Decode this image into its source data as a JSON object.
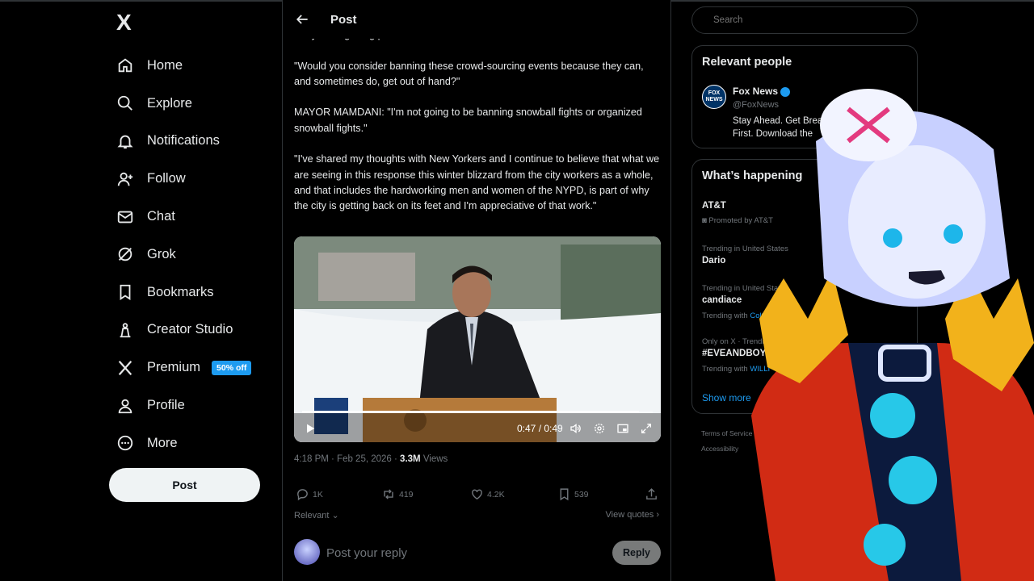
{
  "logo": "X",
  "nav": [
    {
      "label": "Home",
      "icon": "home-icon"
    },
    {
      "label": "Explore",
      "icon": "search-icon"
    },
    {
      "label": "Notifications",
      "icon": "bell-icon"
    },
    {
      "label": "Follow",
      "icon": "follow-icon"
    },
    {
      "label": "Chat",
      "icon": "mail-icon"
    },
    {
      "label": "Grok",
      "icon": "grok-icon"
    },
    {
      "label": "Bookmarks",
      "icon": "bookmark-icon"
    },
    {
      "label": "Creator Studio",
      "icon": "creator-icon"
    },
    {
      "label": "Premium",
      "icon": "x-icon",
      "badge": "50% off"
    },
    {
      "label": "Profile",
      "icon": "person-icon"
    },
    {
      "label": "More",
      "icon": "more-icon"
    }
  ],
  "post_button": "Post",
  "header": {
    "title": "Post"
  },
  "tweet": {
    "text": "They were getting pelted themselves...\n\n\"Would you consider banning these crowd-sourcing events because they can, and sometimes do, get out of hand?\"\n\nMAYOR MAMDANI: \"I'm not going to be banning snowball fights or organized snowball fights.\"\n\n\"I've shared my thoughts with New Yorkers and I continue to believe that what we are seeing in this response this winter blizzard from the city workers as a whole, and that includes the hardworking men and women of the NYPD, is part of why the city is getting back on its feet and I'm appreciative of that work.\"",
    "video_time": "0:47 / 0:49",
    "video_progress": 0.96,
    "timestamp": "4:18 PM · Feb 25, 2026 · ",
    "views_count": "3.3M",
    "views_label": " Views",
    "replies": "1K",
    "reposts": "419",
    "likes": "4.2K",
    "bookmarks": "539",
    "relevant": "Relevant",
    "view_quotes": "View quotes"
  },
  "reply": {
    "placeholder": "Post your reply",
    "button": "Reply"
  },
  "search": {
    "placeholder": "Search"
  },
  "relevant_people": {
    "title": "Relevant people",
    "name": "Fox News",
    "handle": "@FoxNews",
    "bio_line1": "Stay Ahead. Get Breakin",
    "bio_line2": "First. Download the"
  },
  "whats_happening": {
    "title": "What’s happening",
    "trends": [
      {
        "main": "AT&T",
        "sub": "Promoted by AT&T"
      },
      {
        "sub": "Trending in United States",
        "main": "Dario"
      },
      {
        "sub": "Trending in United States",
        "main": "candiace",
        "extra": "Trending with ",
        "link": "Colton"
      },
      {
        "sub": "Only on X · Trending",
        "main": "#EVEANDBOYXV",
        "extra": "Trending with ",
        "link": "WILLI"
      }
    ],
    "show_more": "Show more"
  },
  "footer": {
    "line1": "Terms of Service",
    "line2": "Accessibility"
  },
  "colors": {
    "accent": "#1d9bf0",
    "bg": "#000000",
    "text": "#e7e9ea",
    "muted": "#71767b"
  }
}
